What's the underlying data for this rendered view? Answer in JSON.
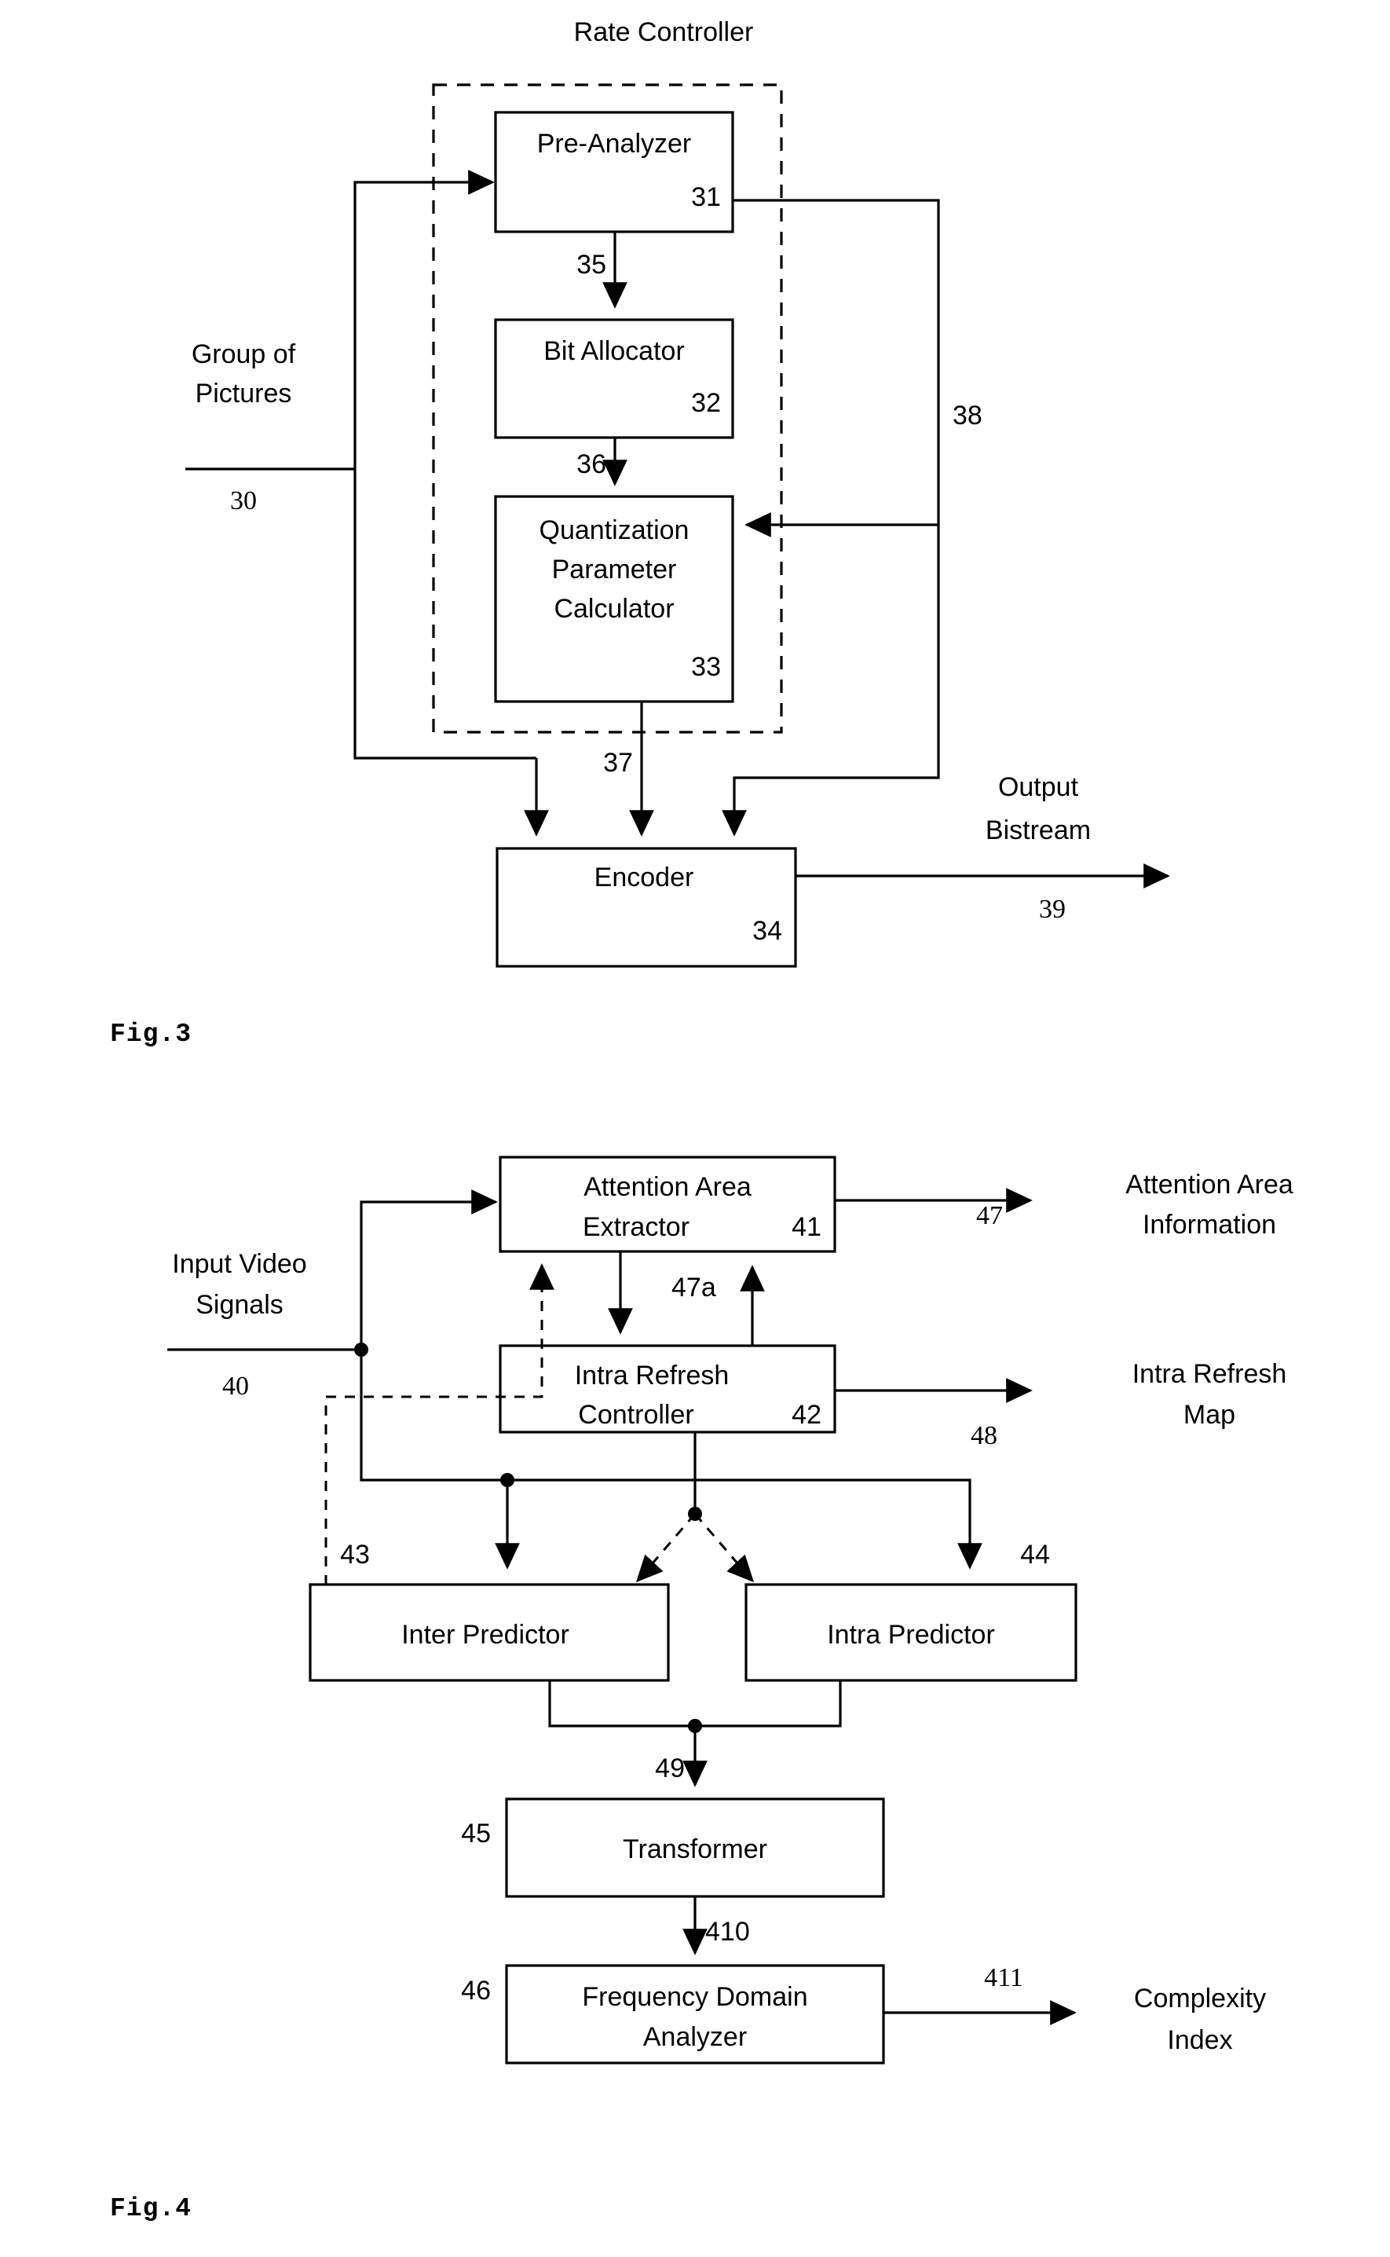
{
  "figures": [
    {
      "id": "fig3",
      "caption": "Fig.3",
      "title": "Rate Controller",
      "boxes": [
        {
          "id": "pre_analyzer",
          "label": "Pre-Analyzer",
          "ref": "31"
        },
        {
          "id": "bit_allocator",
          "label": "Bit Allocator",
          "ref": "32"
        },
        {
          "id": "qp_calculator",
          "label_line1": "Quantization",
          "label_line2": "Parameter",
          "label_line3": "Calculator",
          "ref": "33"
        },
        {
          "id": "encoder",
          "label": "Encoder",
          "ref": "34"
        }
      ],
      "external_labels": [
        {
          "id": "group_of_pictures",
          "line1": "Group of",
          "line2": "Pictures",
          "ref": "30"
        },
        {
          "id": "output_bistream",
          "line1": "Output",
          "line2": "Bistream",
          "ref": "39"
        }
      ],
      "signal_refs": [
        "35",
        "36",
        "37",
        "38"
      ]
    },
    {
      "id": "fig4",
      "caption": "Fig.4",
      "boxes": [
        {
          "id": "attention_area_extractor",
          "label_line1": "Attention Area",
          "label_line2": "Extractor",
          "ref": "41"
        },
        {
          "id": "intra_refresh_controller",
          "label_line1": "Intra Refresh",
          "label_line2": "Controller",
          "ref": "42"
        },
        {
          "id": "inter_predictor",
          "label": "Inter Predictor",
          "ref": "43"
        },
        {
          "id": "intra_predictor",
          "label": "Intra Predictor",
          "ref": "44"
        },
        {
          "id": "transformer",
          "label": "Transformer",
          "ref": "45"
        },
        {
          "id": "frequency_domain_analyzer",
          "label_line1": "Frequency Domain",
          "label_line2": "Analyzer",
          "ref": "46"
        }
      ],
      "external_labels": [
        {
          "id": "input_video_signals",
          "line1": "Input Video",
          "line2": "Signals",
          "ref": "40"
        },
        {
          "id": "attention_area_information",
          "line1": "Attention Area",
          "line2": "Information",
          "ref": "47"
        },
        {
          "id": "intra_refresh_map",
          "line1": "Intra Refresh",
          "line2": "Map",
          "ref": "48"
        },
        {
          "id": "complexity_index",
          "line1": "Complexity",
          "line2": "Index",
          "ref": "411"
        }
      ],
      "signal_refs": [
        "47a",
        "49",
        "410"
      ]
    }
  ]
}
